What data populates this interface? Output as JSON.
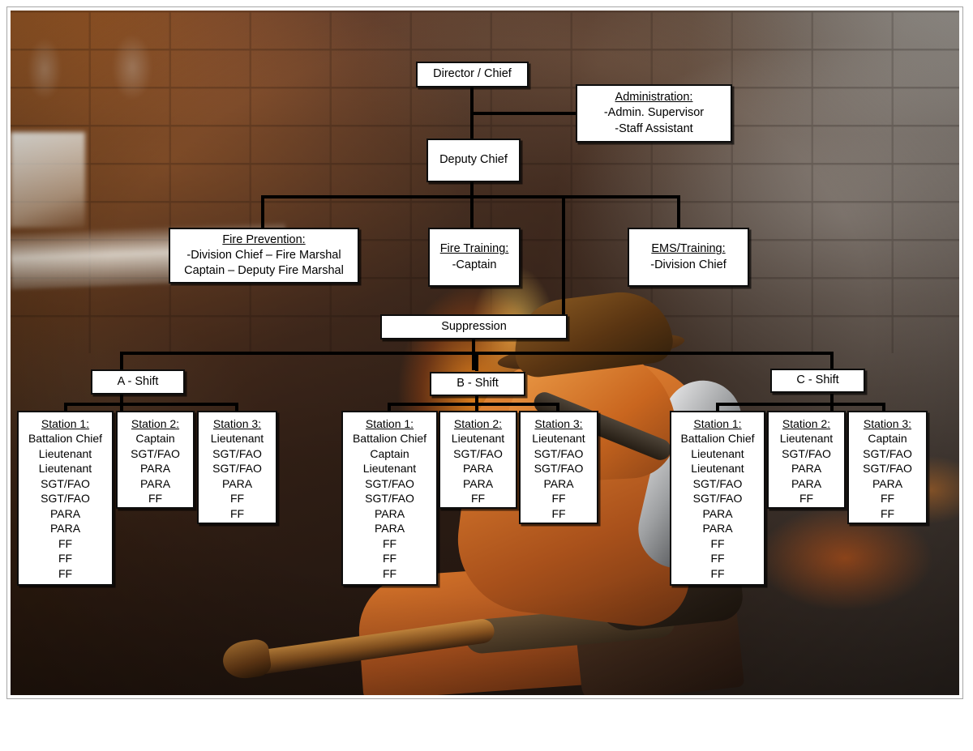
{
  "document": {
    "title": "Fire Department Organizational Chart",
    "background_description": "firefighter-with-hose-in-smoke-filled-room"
  },
  "colors": {
    "box_fill": "#ffffff",
    "box_border": "#0d0d0d",
    "connector": "#000000",
    "text": "#000000",
    "frame_border": "#a6a6a6",
    "page_background": "#ffffff"
  },
  "nodes": {
    "director": {
      "label": "Director / Chief"
    },
    "administration": {
      "header": "Administration:",
      "lines": [
        "-Admin. Supervisor",
        "-Staff Assistant"
      ]
    },
    "deputy_chief": {
      "label": "Deputy Chief"
    },
    "fire_prevention": {
      "header": "Fire Prevention:",
      "lines": [
        "-Division Chief – Fire Marshal",
        "Captain – Deputy Fire Marshal"
      ]
    },
    "fire_training": {
      "header": "Fire Training:",
      "lines": [
        "-Captain"
      ]
    },
    "ems_training": {
      "header": "EMS/Training:",
      "lines": [
        "-Division Chief"
      ]
    },
    "suppression": {
      "label": "Suppression"
    }
  },
  "shifts": [
    {
      "id": "a-shift",
      "label": "A - Shift",
      "stations": [
        {
          "header": "Station 1:",
          "roles": [
            "Battalion Chief",
            "Lieutenant",
            "Lieutenant",
            "SGT/FAO",
            "SGT/FAO",
            "PARA",
            "PARA",
            "FF",
            "FF",
            "FF"
          ]
        },
        {
          "header": "Station 2:",
          "roles": [
            "Captain",
            "SGT/FAO",
            "PARA",
            "PARA",
            "FF"
          ]
        },
        {
          "header": "Station 3:",
          "roles": [
            "Lieutenant",
            "SGT/FAO",
            "SGT/FAO",
            "PARA",
            "FF",
            "FF"
          ]
        }
      ]
    },
    {
      "id": "b-shift",
      "label": "B - Shift",
      "stations": [
        {
          "header": "Station 1:",
          "roles": [
            "Battalion Chief",
            "Captain",
            "Lieutenant",
            "SGT/FAO",
            "SGT/FAO",
            "PARA",
            "PARA",
            "FF",
            "FF",
            "FF"
          ]
        },
        {
          "header": "Station 2:",
          "roles": [
            "Lieutenant",
            "SGT/FAO",
            "PARA",
            "PARA",
            "FF"
          ]
        },
        {
          "header": "Station 3:",
          "roles": [
            "Lieutenant",
            "SGT/FAO",
            "SGT/FAO",
            "PARA",
            "FF",
            "FF"
          ]
        }
      ]
    },
    {
      "id": "c-shift",
      "label": "C - Shift",
      "stations": [
        {
          "header": "Station 1:",
          "roles": [
            "Battalion Chief",
            "Lieutenant",
            "Lieutenant",
            "SGT/FAO",
            "SGT/FAO",
            "PARA",
            "PARA",
            "FF",
            "FF",
            "FF"
          ]
        },
        {
          "header": "Station 2:",
          "roles": [
            "Lieutenant",
            "SGT/FAO",
            "PARA",
            "PARA",
            "FF"
          ]
        },
        {
          "header": "Station 3:",
          "roles": [
            "Captain",
            "SGT/FAO",
            "SGT/FAO",
            "PARA",
            "FF",
            "FF"
          ]
        }
      ]
    }
  ]
}
